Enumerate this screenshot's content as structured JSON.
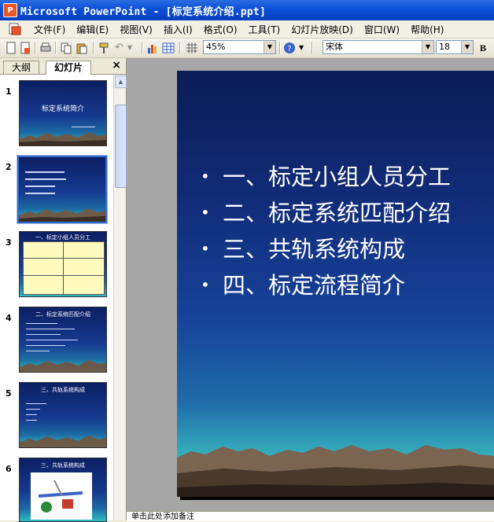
{
  "window": {
    "title": "Microsoft PowerPoint - [标定系统介绍.ppt]"
  },
  "menu": [
    "文件(F)",
    "编辑(E)",
    "视图(V)",
    "插入(I)",
    "格式(O)",
    "工具(T)",
    "幻灯片放映(D)",
    "窗口(W)",
    "帮助(H)"
  ],
  "toolbar": {
    "zoom": "45%",
    "font": "宋体",
    "font_size": "18",
    "bold": "B"
  },
  "pane_tabs": {
    "outline": "大纲",
    "slides": "幻灯片",
    "close": "×"
  },
  "slides": [
    {
      "num": "1",
      "title": "标定系统简介"
    },
    {
      "num": "2",
      "title": ""
    },
    {
      "num": "3",
      "title": "一、标定小组人员分工"
    },
    {
      "num": "4",
      "title": "二、标定系统匹配介绍"
    },
    {
      "num": "5",
      "title": "三、共轨系统构成"
    },
    {
      "num": "6",
      "title": "三、共轨系统构成"
    }
  ],
  "current_slide": {
    "bullets": [
      "一、标定小组人员分工",
      "二、标定系统匹配介绍",
      "三、共轨系统构成",
      "四、标定流程简介"
    ]
  },
  "notes": {
    "placeholder": "单击此处添加备注"
  },
  "colors": {
    "titlebar": "#0a4fd6",
    "selection": "#316ac5"
  }
}
